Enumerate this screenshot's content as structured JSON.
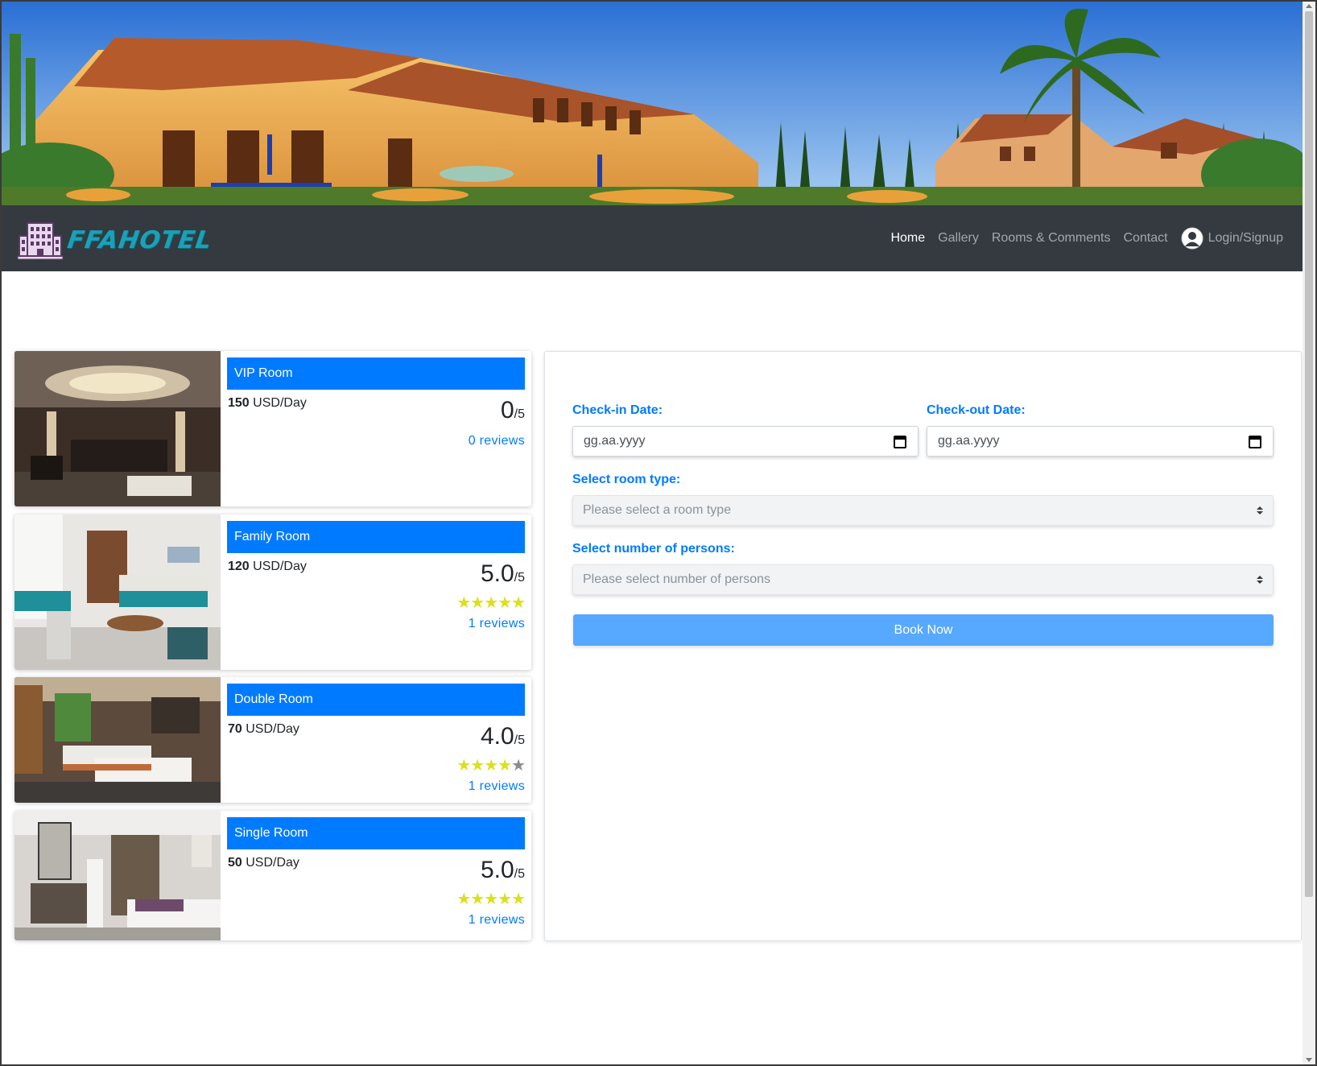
{
  "brand": {
    "name": "FFAHOTEL"
  },
  "nav": {
    "home": "Home",
    "gallery": "Gallery",
    "rooms": "Rooms & Comments",
    "contact": "Contact",
    "login": "Login/Signup"
  },
  "rooms": [
    {
      "title": "VIP Room",
      "price": "150",
      "price_unit": "USD/Day",
      "score": "0",
      "score_suffix": "/5",
      "stars": 0,
      "reviews": "0 reviews"
    },
    {
      "title": "Family Room",
      "price": "120",
      "price_unit": "USD/Day",
      "score": "5.0",
      "score_suffix": "/5",
      "stars": 5,
      "reviews": "1 reviews"
    },
    {
      "title": "Double Room",
      "price": "70",
      "price_unit": "USD/Day",
      "score": "4.0",
      "score_suffix": "/5",
      "stars": 4,
      "reviews": "1 reviews"
    },
    {
      "title": "Single Room",
      "price": "50",
      "price_unit": "USD/Day",
      "score": "5.0",
      "score_suffix": "/5",
      "stars": 5,
      "reviews": "1 reviews"
    }
  ],
  "booking": {
    "checkin_label": "Check-in Date:",
    "checkin_placeholder": "gg.aa.yyyy",
    "checkout_label": "Check-out Date:",
    "checkout_placeholder": "gg.aa.yyyy",
    "room_type_label": "Select room type:",
    "room_type_value": "Please select a room type",
    "persons_label": "Select number of persons:",
    "persons_value": "Please select number of persons",
    "submit": "Book Now"
  },
  "colors": {
    "accent": "#007bff",
    "navbar": "#343a40",
    "brand": "#17a2b8",
    "star_on": "#dbe01c",
    "star_off": "#8c8c8c",
    "button": "#57a8ff"
  }
}
